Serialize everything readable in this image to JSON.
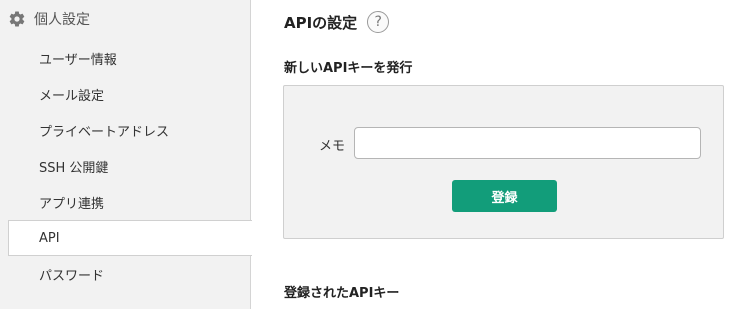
{
  "sidebar": {
    "title": "個人設定",
    "icon": "gear-icon",
    "items": [
      {
        "label": "ユーザー情報"
      },
      {
        "label": "メール設定"
      },
      {
        "label": "プライベートアドレス"
      },
      {
        "label": "SSH 公開鍵"
      },
      {
        "label": "アプリ連携"
      },
      {
        "label": "API",
        "active": true
      },
      {
        "label": "パスワード"
      }
    ]
  },
  "main": {
    "page_title": "APIの設定",
    "help_icon": "?",
    "new_key_section": {
      "title": "新しいAPIキーを発行",
      "memo_label": "メモ",
      "memo_value": "",
      "register_button": "登録"
    },
    "registered_section": {
      "title": "登録されたAPIキー"
    }
  },
  "colors": {
    "accent": "#129d7a",
    "sidebar_bg": "#f2f2f2"
  }
}
